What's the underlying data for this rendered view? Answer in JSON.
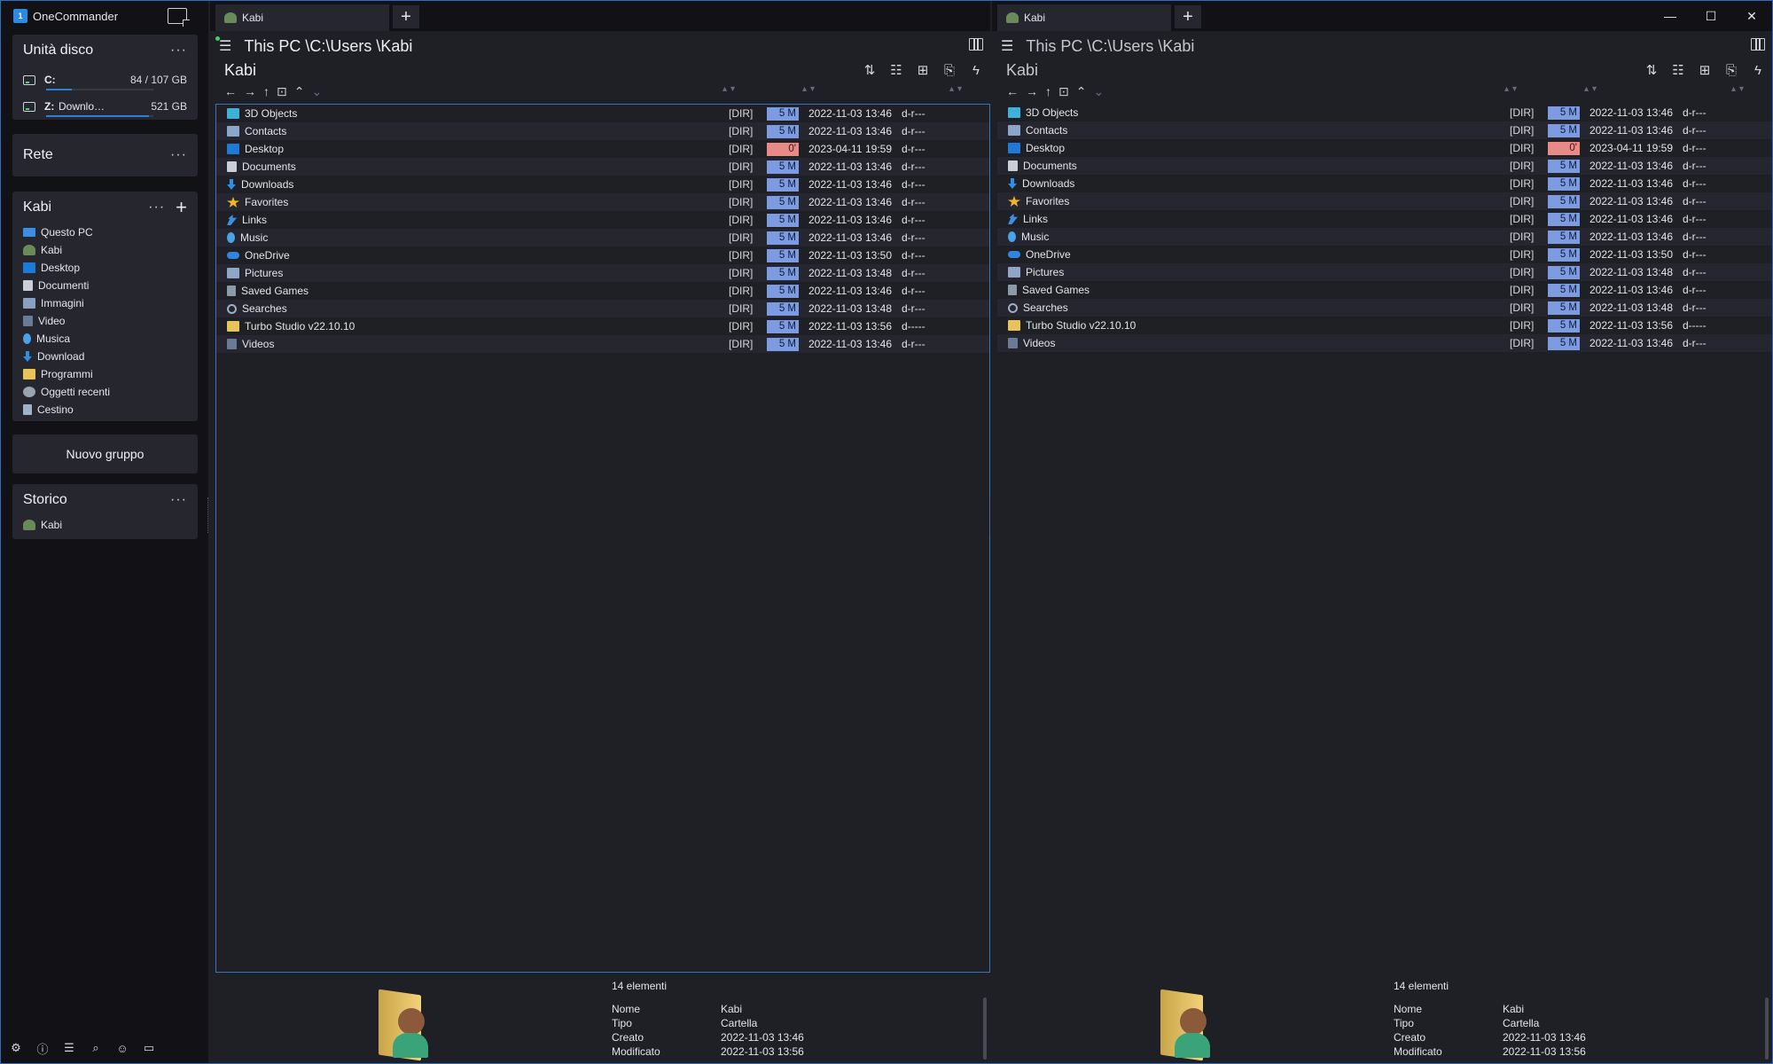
{
  "app": {
    "title": "OneCommander"
  },
  "sidebar": {
    "drives": {
      "title": "Unità disco",
      "items": [
        {
          "letter": "C:",
          "name": "",
          "size": "84 / 107 GB",
          "used_fraction": 0.24
        },
        {
          "letter": "Z:",
          "name": "Download (\\\\VB...",
          "size": "521 GB",
          "used_fraction": 0.96
        }
      ]
    },
    "network": {
      "title": "Rete"
    },
    "favorites": {
      "title": "Kabi",
      "items": [
        {
          "label": "Questo PC",
          "icon": "pc-icon"
        },
        {
          "label": "Kabi",
          "icon": "user-folder-icon"
        },
        {
          "label": "Desktop",
          "icon": "desktop-icon"
        },
        {
          "label": "Documenti",
          "icon": "documents-icon"
        },
        {
          "label": "Immagini",
          "icon": "pictures-icon"
        },
        {
          "label": "Video",
          "icon": "video-icon"
        },
        {
          "label": "Musica",
          "icon": "music-icon"
        },
        {
          "label": "Download",
          "icon": "download-icon"
        },
        {
          "label": "Programmi",
          "icon": "folder-icon"
        },
        {
          "label": "Oggetti recenti",
          "icon": "recent-icon"
        },
        {
          "label": "Cestino",
          "icon": "recycle-bin-icon"
        }
      ]
    },
    "new_group_label": "Nuovo gruppo",
    "history": {
      "title": "Storico",
      "items": [
        {
          "label": "Kabi"
        }
      ]
    }
  },
  "panes": [
    {
      "tab": "Kabi",
      "path": "This PC \\C:\\Users \\Kabi",
      "folder": "Kabi",
      "status": "14 elementi",
      "props": [
        {
          "k": "Nome",
          "v": "Kabi"
        },
        {
          "k": "Tipo",
          "v": "Cartella"
        },
        {
          "k": "Creato",
          "v": "2022-11-03  13:46"
        },
        {
          "k": "Modificato",
          "v": "2022-11-03  13:56"
        }
      ]
    },
    {
      "tab": "Kabi",
      "path": "This PC \\C:\\Users \\Kabi",
      "folder": "Kabi",
      "status": "14 elementi",
      "props": [
        {
          "k": "Nome",
          "v": "Kabi"
        },
        {
          "k": "Tipo",
          "v": "Cartella"
        },
        {
          "k": "Creato",
          "v": "2022-11-03  13:46"
        },
        {
          "k": "Modificato",
          "v": "2022-11-03  13:56"
        }
      ]
    }
  ],
  "files": [
    {
      "name": "3D Objects",
      "icon": "3d-objects",
      "type": "[DIR]",
      "size": "5 M",
      "hot": false,
      "date": "2022-11-03",
      "time": "13:46",
      "attr": "d-r---"
    },
    {
      "name": "Contacts",
      "icon": "contacts",
      "type": "[DIR]",
      "size": "5 M",
      "hot": false,
      "date": "2022-11-03",
      "time": "13:46",
      "attr": "d-r---"
    },
    {
      "name": "Desktop",
      "icon": "desktop",
      "type": "[DIR]",
      "size": "0'",
      "hot": true,
      "date": "2023-04-11",
      "time": "19:59",
      "attr": "d-r---"
    },
    {
      "name": "Documents",
      "icon": "documents",
      "type": "[DIR]",
      "size": "5 M",
      "hot": false,
      "date": "2022-11-03",
      "time": "13:46",
      "attr": "d-r---"
    },
    {
      "name": "Downloads",
      "icon": "downloads",
      "type": "[DIR]",
      "size": "5 M",
      "hot": false,
      "date": "2022-11-03",
      "time": "13:46",
      "attr": "d-r---"
    },
    {
      "name": "Favorites",
      "icon": "favorites",
      "type": "[DIR]",
      "size": "5 M",
      "hot": false,
      "date": "2022-11-03",
      "time": "13:46",
      "attr": "d-r---"
    },
    {
      "name": "Links",
      "icon": "links",
      "type": "[DIR]",
      "size": "5 M",
      "hot": false,
      "date": "2022-11-03",
      "time": "13:46",
      "attr": "d-r---"
    },
    {
      "name": "Music",
      "icon": "music",
      "type": "[DIR]",
      "size": "5 M",
      "hot": false,
      "date": "2022-11-03",
      "time": "13:46",
      "attr": "d-r---"
    },
    {
      "name": "OneDrive",
      "icon": "onedrive",
      "type": "[DIR]",
      "size": "5 M",
      "hot": false,
      "date": "2022-11-03",
      "time": "13:50",
      "attr": "d-r---"
    },
    {
      "name": "Pictures",
      "icon": "pictures",
      "type": "[DIR]",
      "size": "5 M",
      "hot": false,
      "date": "2022-11-03",
      "time": "13:48",
      "attr": "d-r---"
    },
    {
      "name": "Saved Games",
      "icon": "saved-games",
      "type": "[DIR]",
      "size": "5 M",
      "hot": false,
      "date": "2022-11-03",
      "time": "13:46",
      "attr": "d-r---"
    },
    {
      "name": "Searches",
      "icon": "searches",
      "type": "[DIR]",
      "size": "5 M",
      "hot": false,
      "date": "2022-11-03",
      "time": "13:48",
      "attr": "d-r---"
    },
    {
      "name": "Turbo Studio v22.10.10",
      "icon": "folder",
      "type": "[DIR]",
      "size": "5 M",
      "hot": false,
      "date": "2022-11-03",
      "time": "13:56",
      "attr": "d-----"
    },
    {
      "name": "Videos",
      "icon": "videos",
      "type": "[DIR]",
      "size": "5 M",
      "hot": false,
      "date": "2022-11-03",
      "time": "13:46",
      "attr": "d-r---"
    }
  ],
  "colors": {
    "accent": "#2f7fd8",
    "size_bar": "#7d9be0",
    "size_hot": "#e88a86",
    "online": "#3fd06a"
  }
}
